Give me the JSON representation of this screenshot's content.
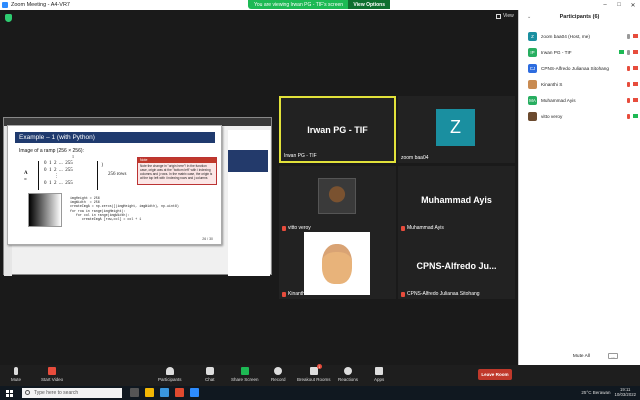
{
  "window": {
    "title": "Zoom Meeting - A4-VR7",
    "banner": "You are viewing Irwan PG - TIF's screen",
    "view_options": "View Options",
    "view_label": "View"
  },
  "share": {
    "slide_title": "Example – 1 (with Python)",
    "subtitle": "Image of a ramp (256 × 256):",
    "matrix_label": "A =",
    "matrix_rows": "0  1  2  ...  255\n0  1  2  ...  255\n        ⋮\n0  1  2  ...  255",
    "rows_label": "256 rows",
    "col_note": "1",
    "note_title": "Note",
    "note_body": "Note the change in \"origin here\"! In the function case, origin was at the \"bottom left\" with i indexing columns and j rows. In the matrix case, the origin is at the top left with i indexing rows and j columns",
    "code": "imgHeight = 256\nimgWidth  = 256\ncreateImgA = np.zeros([(imgHeight, imgWidth), np.uint8)\nfor row in range(imgHeight):\n   for col in range(imgWidth):\n      createImgA [row,col] = col + 1",
    "page": "26 / 30"
  },
  "tiles": [
    {
      "big": "Irwan PG - TIF",
      "name": "Irwan PG - TIF"
    },
    {
      "initial": "Z",
      "name": "zoom baa04"
    },
    {
      "name": "vitto veroy"
    },
    {
      "big": "Muhammad Ayis",
      "name": "Muhammad Ayis"
    },
    {
      "name": "Kinanthi"
    },
    {
      "big": "CPNS-Alfredo  Ju...",
      "name": "CPNS-Alfredo Julianaa Sitohang"
    }
  ],
  "participants": {
    "header": "Participants (6)",
    "items": [
      {
        "initials": "Z",
        "color": "#1a8fa0",
        "name": "zoom baa04 (Host, me)"
      },
      {
        "initials": "IP",
        "color": "#27ae60",
        "name": "Irwan PG - TIF"
      },
      {
        "initials": "CJ",
        "color": "#2d6cdf",
        "name": "CPNS-Alfredo Julianaa Sitohang"
      },
      {
        "initials": "",
        "color": "#c98b52",
        "name": "Kinanthi S"
      },
      {
        "initials": "MA",
        "color": "#27ae60",
        "name": "Muhammad Ayis"
      },
      {
        "initials": "",
        "color": "#6b4a2e",
        "name": "vitto veroy"
      }
    ],
    "mute_all": "Mute All",
    "more": "..."
  },
  "toolbar": {
    "mute": "Mute",
    "start_video": "Start Video",
    "participants": "Participants",
    "participants_count": "6",
    "chat": "Chat",
    "share_screen": "Share Screen",
    "record": "Record",
    "breakout": "Breakout Rooms",
    "breakout_badge": "1",
    "reactions": "Reactions",
    "apps": "Apps",
    "leave": "Leave Room"
  },
  "taskbar": {
    "search_placeholder": "Type here to search",
    "weather": "25°C  Berawan",
    "time": "19:11",
    "date": "10/03/2022"
  }
}
